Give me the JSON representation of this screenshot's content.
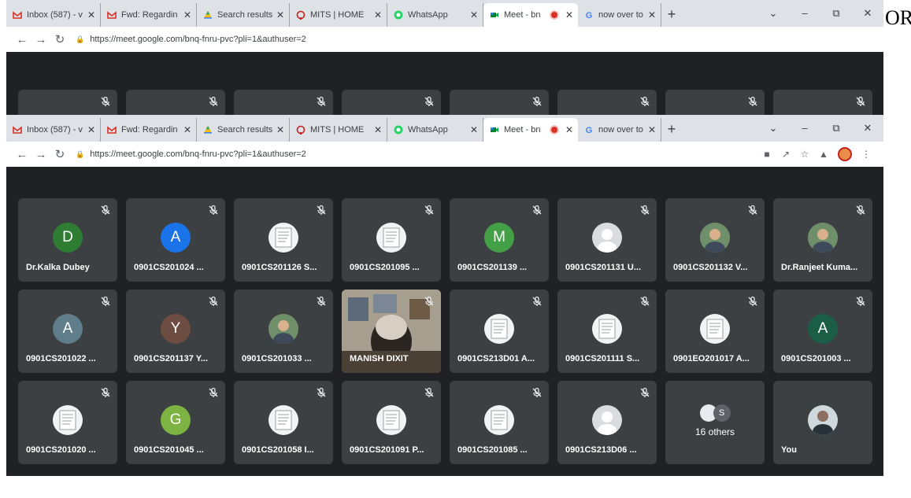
{
  "browser": {
    "tabs": [
      {
        "title": "Inbox (587) - v",
        "icon": "gmail-icon",
        "active": false
      },
      {
        "title": "Fwd: Regardin",
        "icon": "gmail-icon",
        "active": false
      },
      {
        "title": "Search results",
        "icon": "drive-icon",
        "active": false
      },
      {
        "title": "MITS | HOME",
        "icon": "mits-icon",
        "active": false
      },
      {
        "title": "WhatsApp",
        "icon": "whatsapp-icon",
        "active": false
      },
      {
        "title": "Meet - bn",
        "icon": "meet-icon",
        "active": true,
        "recording": true
      },
      {
        "title": "now over to yo",
        "icon": "google-icon",
        "active": false
      }
    ],
    "url": "https://meet.google.com/bnq-fnru-pvc?pli=1&authuser=2",
    "new_tab": "+",
    "window_controls": {
      "minimize": "–",
      "restore": "⧉",
      "close": "✕"
    }
  },
  "meet": {
    "participants": [
      {
        "name": "Dr.Kalka Dubey",
        "avatar": "D",
        "color": "#2e7d32",
        "kind": "letter"
      },
      {
        "name": "0901CS201024 ...",
        "avatar": "A",
        "color": "#1a73e8",
        "kind": "letter"
      },
      {
        "name": "0901CS201126 S...",
        "avatar": "",
        "color": "",
        "kind": "doc"
      },
      {
        "name": "0901CS201095 ...",
        "avatar": "",
        "color": "",
        "kind": "doc"
      },
      {
        "name": "0901CS201139 ...",
        "avatar": "M",
        "color": "#43a047",
        "kind": "letter"
      },
      {
        "name": "0901CS201131 U...",
        "avatar": "",
        "color": "",
        "kind": "gray"
      },
      {
        "name": "0901CS201132 V...",
        "avatar": "",
        "color": "",
        "kind": "photo"
      },
      {
        "name": "Dr.Ranjeet Kuma...",
        "avatar": "",
        "color": "",
        "kind": "photo"
      },
      {
        "name": "0901CS201022 ...",
        "avatar": "A",
        "color": "#607d8b",
        "kind": "letter"
      },
      {
        "name": "0901CS201137 Y...",
        "avatar": "Y",
        "color": "#6d4c41",
        "kind": "letter"
      },
      {
        "name": "0901CS201033 ...",
        "avatar": "",
        "color": "",
        "kind": "photo"
      },
      {
        "name": "MANISH DIXIT",
        "avatar": "",
        "color": "",
        "kind": "video"
      },
      {
        "name": "0901CS213D01 A...",
        "avatar": "",
        "color": "",
        "kind": "doc"
      },
      {
        "name": "0901CS201111 S...",
        "avatar": "",
        "color": "",
        "kind": "doc"
      },
      {
        "name": "0901EO201017 A...",
        "avatar": "",
        "color": "",
        "kind": "doc"
      },
      {
        "name": "0901CS201003 ...",
        "avatar": "A",
        "color": "#1b5e45",
        "kind": "letter"
      },
      {
        "name": "0901CS201020 ...",
        "avatar": "",
        "color": "",
        "kind": "doc"
      },
      {
        "name": "0901CS201045 ...",
        "avatar": "G",
        "color": "#7cb342",
        "kind": "letter"
      },
      {
        "name": "0901CS201058 I...",
        "avatar": "",
        "color": "",
        "kind": "doc"
      },
      {
        "name": "0901CS201091 P...",
        "avatar": "",
        "color": "",
        "kind": "doc"
      },
      {
        "name": "0901CS201085 ...",
        "avatar": "",
        "color": "",
        "kind": "doc"
      },
      {
        "name": "0901CS213D06 ...",
        "avatar": "",
        "color": "",
        "kind": "gray"
      }
    ],
    "others": {
      "label": "16 others",
      "avatar": "S"
    },
    "self": {
      "name": "You"
    }
  },
  "overlay_text": "OR"
}
